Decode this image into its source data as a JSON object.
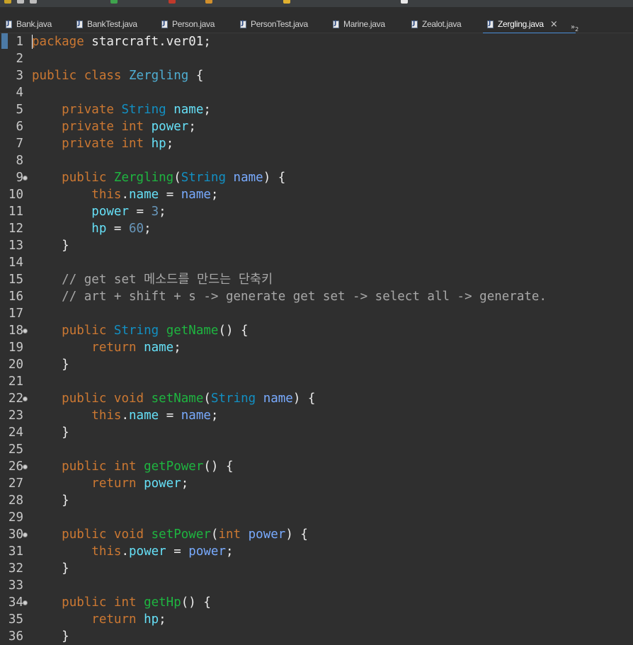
{
  "colors": {
    "background": "#2f2f2f",
    "keyword": "#cc7832",
    "type": "#1290c3",
    "class_name": "#4faed2",
    "field": "#66e1f8",
    "parameter": "#79abff",
    "method": "#1eb540",
    "number": "#6897bb",
    "comment": "#a8a8a8",
    "tab_active_underline": "#4a8fd8"
  },
  "tabs": [
    {
      "label": "Bank.java",
      "icon": "java-file-icon"
    },
    {
      "label": "BankTest.java",
      "icon": "java-file-icon"
    },
    {
      "label": "Person.java",
      "icon": "java-file-icon"
    },
    {
      "label": "PersonTest.java",
      "icon": "java-file-icon"
    },
    {
      "label": "Marine.java",
      "icon": "java-file-icon"
    },
    {
      "label": "Zealot.java",
      "icon": "java-file-icon"
    },
    {
      "label": "Zergling.java",
      "icon": "java-file-icon",
      "active": true,
      "close": "×"
    }
  ],
  "overflow": {
    "symbol": "»",
    "count": "2"
  },
  "editor": {
    "lines": [
      {
        "n": "1",
        "tokens": [
          [
            "kw",
            "package"
          ],
          [
            "t",
            " starcraft.ver01;"
          ]
        ]
      },
      {
        "n": "2",
        "tokens": []
      },
      {
        "n": "3",
        "tokens": [
          [
            "kw",
            "public"
          ],
          [
            "t",
            " "
          ],
          [
            "kw",
            "class"
          ],
          [
            "t",
            " "
          ],
          [
            "cls",
            "Zergling"
          ],
          [
            "t",
            " {"
          ]
        ]
      },
      {
        "n": "4",
        "tokens": []
      },
      {
        "n": "5",
        "tokens": [
          [
            "t",
            "    "
          ],
          [
            "kw",
            "private"
          ],
          [
            "t",
            " "
          ],
          [
            "type",
            "String"
          ],
          [
            "t",
            " "
          ],
          [
            "fld2",
            "name"
          ],
          [
            "t",
            ";"
          ]
        ]
      },
      {
        "n": "6",
        "tokens": [
          [
            "t",
            "    "
          ],
          [
            "kw",
            "private"
          ],
          [
            "t",
            " "
          ],
          [
            "kw",
            "int"
          ],
          [
            "t",
            " "
          ],
          [
            "fld2",
            "power"
          ],
          [
            "t",
            ";"
          ]
        ]
      },
      {
        "n": "7",
        "tokens": [
          [
            "t",
            "    "
          ],
          [
            "kw",
            "private"
          ],
          [
            "t",
            " "
          ],
          [
            "kw",
            "int"
          ],
          [
            "t",
            " "
          ],
          [
            "fld2",
            "hp"
          ],
          [
            "t",
            ";"
          ]
        ]
      },
      {
        "n": "8",
        "tokens": []
      },
      {
        "n": "9",
        "fold": true,
        "tokens": [
          [
            "t",
            "    "
          ],
          [
            "kw",
            "public"
          ],
          [
            "t",
            " "
          ],
          [
            "meth",
            "Zergling"
          ],
          [
            "t",
            "("
          ],
          [
            "type",
            "String"
          ],
          [
            "t",
            " "
          ],
          [
            "par",
            "name"
          ],
          [
            "t",
            ") {"
          ]
        ]
      },
      {
        "n": "10",
        "tokens": [
          [
            "t",
            "        "
          ],
          [
            "kw",
            "this"
          ],
          [
            "t",
            "."
          ],
          [
            "fld2",
            "name"
          ],
          [
            "t",
            " = "
          ],
          [
            "par",
            "name"
          ],
          [
            "t",
            ";"
          ]
        ]
      },
      {
        "n": "11",
        "tokens": [
          [
            "t",
            "        "
          ],
          [
            "fld2",
            "power"
          ],
          [
            "t",
            " = "
          ],
          [
            "num",
            "3"
          ],
          [
            "t",
            ";"
          ]
        ]
      },
      {
        "n": "12",
        "tokens": [
          [
            "t",
            "        "
          ],
          [
            "fld2",
            "hp"
          ],
          [
            "t",
            " = "
          ],
          [
            "num",
            "60"
          ],
          [
            "t",
            ";"
          ]
        ]
      },
      {
        "n": "13",
        "tokens": [
          [
            "t",
            "    }"
          ]
        ]
      },
      {
        "n": "14",
        "tokens": []
      },
      {
        "n": "15",
        "tokens": [
          [
            "t",
            "    "
          ],
          [
            "cmt",
            "// get set 메소드를 만드는 단축키"
          ]
        ]
      },
      {
        "n": "16",
        "tokens": [
          [
            "t",
            "    "
          ],
          [
            "cmt",
            "// art + shift + s -> generate get set -> select all -> generate."
          ]
        ]
      },
      {
        "n": "17",
        "tokens": []
      },
      {
        "n": "18",
        "fold": true,
        "tokens": [
          [
            "t",
            "    "
          ],
          [
            "kw",
            "public"
          ],
          [
            "t",
            " "
          ],
          [
            "type",
            "String"
          ],
          [
            "t",
            " "
          ],
          [
            "meth",
            "getName"
          ],
          [
            "t",
            "() {"
          ]
        ]
      },
      {
        "n": "19",
        "tokens": [
          [
            "t",
            "        "
          ],
          [
            "kw",
            "return"
          ],
          [
            "t",
            " "
          ],
          [
            "fld2",
            "name"
          ],
          [
            "t",
            ";"
          ]
        ]
      },
      {
        "n": "20",
        "tokens": [
          [
            "t",
            "    }"
          ]
        ]
      },
      {
        "n": "21",
        "tokens": []
      },
      {
        "n": "22",
        "fold": true,
        "tokens": [
          [
            "t",
            "    "
          ],
          [
            "kw",
            "public"
          ],
          [
            "t",
            " "
          ],
          [
            "kw",
            "void"
          ],
          [
            "t",
            " "
          ],
          [
            "meth",
            "setName"
          ],
          [
            "t",
            "("
          ],
          [
            "type",
            "String"
          ],
          [
            "t",
            " "
          ],
          [
            "par",
            "name"
          ],
          [
            "t",
            ") {"
          ]
        ]
      },
      {
        "n": "23",
        "tokens": [
          [
            "t",
            "        "
          ],
          [
            "kw",
            "this"
          ],
          [
            "t",
            "."
          ],
          [
            "fld2",
            "name"
          ],
          [
            "t",
            " = "
          ],
          [
            "par",
            "name"
          ],
          [
            "t",
            ";"
          ]
        ]
      },
      {
        "n": "24",
        "tokens": [
          [
            "t",
            "    }"
          ]
        ]
      },
      {
        "n": "25",
        "tokens": []
      },
      {
        "n": "26",
        "fold": true,
        "tokens": [
          [
            "t",
            "    "
          ],
          [
            "kw",
            "public"
          ],
          [
            "t",
            " "
          ],
          [
            "kw",
            "int"
          ],
          [
            "t",
            " "
          ],
          [
            "meth",
            "getPower"
          ],
          [
            "t",
            "() {"
          ]
        ]
      },
      {
        "n": "27",
        "tokens": [
          [
            "t",
            "        "
          ],
          [
            "kw",
            "return"
          ],
          [
            "t",
            " "
          ],
          [
            "fld2",
            "power"
          ],
          [
            "t",
            ";"
          ]
        ]
      },
      {
        "n": "28",
        "tokens": [
          [
            "t",
            "    }"
          ]
        ]
      },
      {
        "n": "29",
        "tokens": []
      },
      {
        "n": "30",
        "fold": true,
        "tokens": [
          [
            "t",
            "    "
          ],
          [
            "kw",
            "public"
          ],
          [
            "t",
            " "
          ],
          [
            "kw",
            "void"
          ],
          [
            "t",
            " "
          ],
          [
            "meth",
            "setPower"
          ],
          [
            "t",
            "("
          ],
          [
            "kw",
            "int"
          ],
          [
            "t",
            " "
          ],
          [
            "par",
            "power"
          ],
          [
            "t",
            ") {"
          ]
        ]
      },
      {
        "n": "31",
        "tokens": [
          [
            "t",
            "        "
          ],
          [
            "kw",
            "this"
          ],
          [
            "t",
            "."
          ],
          [
            "fld2",
            "power"
          ],
          [
            "t",
            " = "
          ],
          [
            "par",
            "power"
          ],
          [
            "t",
            ";"
          ]
        ]
      },
      {
        "n": "32",
        "tokens": [
          [
            "t",
            "    }"
          ]
        ]
      },
      {
        "n": "33",
        "tokens": []
      },
      {
        "n": "34",
        "fold": true,
        "tokens": [
          [
            "t",
            "    "
          ],
          [
            "kw",
            "public"
          ],
          [
            "t",
            " "
          ],
          [
            "kw",
            "int"
          ],
          [
            "t",
            " "
          ],
          [
            "meth",
            "getHp"
          ],
          [
            "t",
            "() {"
          ]
        ]
      },
      {
        "n": "35",
        "tokens": [
          [
            "t",
            "        "
          ],
          [
            "kw",
            "return"
          ],
          [
            "t",
            " "
          ],
          [
            "fld2",
            "hp"
          ],
          [
            "t",
            ";"
          ]
        ]
      },
      {
        "n": "36",
        "tokens": [
          [
            "t",
            "    }"
          ]
        ]
      }
    ]
  }
}
